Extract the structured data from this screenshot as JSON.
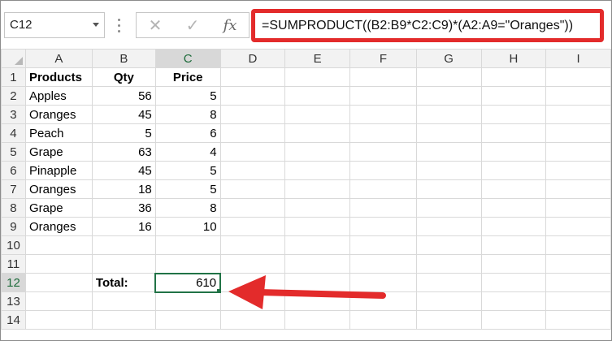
{
  "name_box": {
    "value": "C12"
  },
  "formula_bar": {
    "cancel_glyph": "✕",
    "enter_glyph": "✓",
    "fx_label": "fx",
    "formula": "=SUMPRODUCT((B2:B9*C2:C9)*(A2:A9=\"Oranges\"))"
  },
  "columns": [
    "A",
    "B",
    "C",
    "D",
    "E",
    "F",
    "G",
    "H",
    "I"
  ],
  "rows": [
    {
      "num": "1",
      "a": "Products",
      "b": "Qty",
      "c": "Price"
    },
    {
      "num": "2",
      "a": "Apples",
      "b": "56",
      "c": "5"
    },
    {
      "num": "3",
      "a": "Oranges",
      "b": "45",
      "c": "8"
    },
    {
      "num": "4",
      "a": "Peach",
      "b": "5",
      "c": "6"
    },
    {
      "num": "5",
      "a": "Grape",
      "b": "63",
      "c": "4"
    },
    {
      "num": "6",
      "a": "Pinapple",
      "b": "45",
      "c": "5"
    },
    {
      "num": "7",
      "a": "Oranges",
      "b": "18",
      "c": "5"
    },
    {
      "num": "8",
      "a": "Grape",
      "b": "36",
      "c": "8"
    },
    {
      "num": "9",
      "a": "Oranges",
      "b": "16",
      "c": "10"
    },
    {
      "num": "10",
      "a": "",
      "b": "",
      "c": ""
    },
    {
      "num": "11",
      "a": "",
      "b": "",
      "c": ""
    },
    {
      "num": "12",
      "a": "",
      "b": "Total:",
      "c": "610"
    },
    {
      "num": "13",
      "a": "",
      "b": "",
      "c": ""
    },
    {
      "num": "14",
      "a": "",
      "b": "",
      "c": ""
    }
  ],
  "selected_cell": "C12",
  "colors": {
    "highlight": "#e32b2b",
    "selection": "#217346"
  }
}
